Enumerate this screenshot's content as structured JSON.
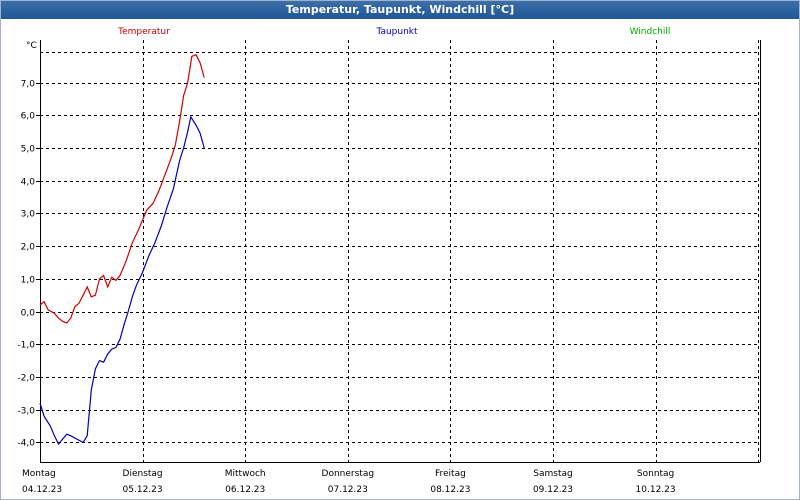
{
  "window": {
    "title": "Temperatur, Taupunkt, Windchill [°C]"
  },
  "chart_data": {
    "type": "line",
    "title": "Temperatur, Taupunkt, Windchill [°C]",
    "ylabel": "°C",
    "ylim": [
      -4.6,
      8.3
    ],
    "yticks": [
      "-4,0",
      "-3,0",
      "-2,0",
      "-1,0",
      "0,0",
      "1,0",
      "2,0",
      "3,0",
      "4,0",
      "5,0",
      "6,0",
      "7,0"
    ],
    "ytick_values": [
      -4,
      -3,
      -2,
      -1,
      0,
      1,
      2,
      3,
      4,
      5,
      6,
      7
    ],
    "xlim": [
      0,
      7.12
    ],
    "x_unit": "days",
    "xticks": [
      {
        "day": "Montag",
        "date": "04.12.23"
      },
      {
        "day": "Dienstag",
        "date": "05.12.23"
      },
      {
        "day": "Mittwoch",
        "date": "06.12.23"
      },
      {
        "day": "Donnerstag",
        "date": "07.12.23"
      },
      {
        "day": "Freitag",
        "date": "08.12.23"
      },
      {
        "day": "Samstag",
        "date": "09.12.23"
      },
      {
        "day": "Sonntag",
        "date": "10.12.23"
      }
    ],
    "grid": true,
    "legend_position": "top",
    "series": [
      {
        "name": "Temperatur",
        "color": "#d00000",
        "points": [
          [
            0.0,
            0.2
          ],
          [
            0.04,
            0.3
          ],
          [
            0.08,
            0.05
          ],
          [
            0.14,
            -0.05
          ],
          [
            0.18,
            -0.2
          ],
          [
            0.22,
            -0.3
          ],
          [
            0.26,
            -0.35
          ],
          [
            0.3,
            -0.2
          ],
          [
            0.34,
            0.15
          ],
          [
            0.38,
            0.25
          ],
          [
            0.42,
            0.5
          ],
          [
            0.46,
            0.75
          ],
          [
            0.5,
            0.45
          ],
          [
            0.54,
            0.5
          ],
          [
            0.58,
            1.0
          ],
          [
            0.62,
            1.1
          ],
          [
            0.66,
            0.75
          ],
          [
            0.7,
            1.05
          ],
          [
            0.74,
            0.95
          ],
          [
            0.78,
            1.1
          ],
          [
            0.84,
            1.55
          ],
          [
            0.9,
            2.1
          ],
          [
            0.96,
            2.5
          ],
          [
            1.0,
            2.8
          ],
          [
            1.04,
            3.1
          ],
          [
            1.1,
            3.3
          ],
          [
            1.16,
            3.7
          ],
          [
            1.22,
            4.2
          ],
          [
            1.28,
            4.7
          ],
          [
            1.32,
            5.1
          ],
          [
            1.36,
            5.8
          ],
          [
            1.4,
            6.6
          ],
          [
            1.44,
            7.0
          ],
          [
            1.46,
            7.4
          ],
          [
            1.48,
            7.8
          ],
          [
            1.52,
            7.85
          ],
          [
            1.56,
            7.6
          ],
          [
            1.6,
            7.15
          ]
        ]
      },
      {
        "name": "Taupunkt",
        "color": "#0000c0",
        "points": [
          [
            0.0,
            -2.8
          ],
          [
            0.04,
            -3.2
          ],
          [
            0.1,
            -3.5
          ],
          [
            0.14,
            -3.8
          ],
          [
            0.18,
            -4.05
          ],
          [
            0.22,
            -3.9
          ],
          [
            0.26,
            -3.75
          ],
          [
            0.3,
            -3.8
          ],
          [
            0.36,
            -3.9
          ],
          [
            0.42,
            -4.0
          ],
          [
            0.46,
            -3.8
          ],
          [
            0.5,
            -2.4
          ],
          [
            0.54,
            -1.75
          ],
          [
            0.58,
            -1.5
          ],
          [
            0.62,
            -1.55
          ],
          [
            0.66,
            -1.3
          ],
          [
            0.7,
            -1.15
          ],
          [
            0.74,
            -1.1
          ],
          [
            0.78,
            -0.85
          ],
          [
            0.82,
            -0.4
          ],
          [
            0.86,
            0.0
          ],
          [
            0.9,
            0.45
          ],
          [
            0.94,
            0.8
          ],
          [
            1.0,
            1.2
          ],
          [
            1.06,
            1.7
          ],
          [
            1.12,
            2.1
          ],
          [
            1.18,
            2.6
          ],
          [
            1.24,
            3.2
          ],
          [
            1.3,
            3.75
          ],
          [
            1.36,
            4.6
          ],
          [
            1.4,
            5.0
          ],
          [
            1.44,
            5.5
          ],
          [
            1.47,
            5.95
          ],
          [
            1.52,
            5.7
          ],
          [
            1.56,
            5.45
          ],
          [
            1.6,
            5.0
          ]
        ]
      },
      {
        "name": "Windchill",
        "color": "#00b000",
        "points": []
      }
    ]
  }
}
